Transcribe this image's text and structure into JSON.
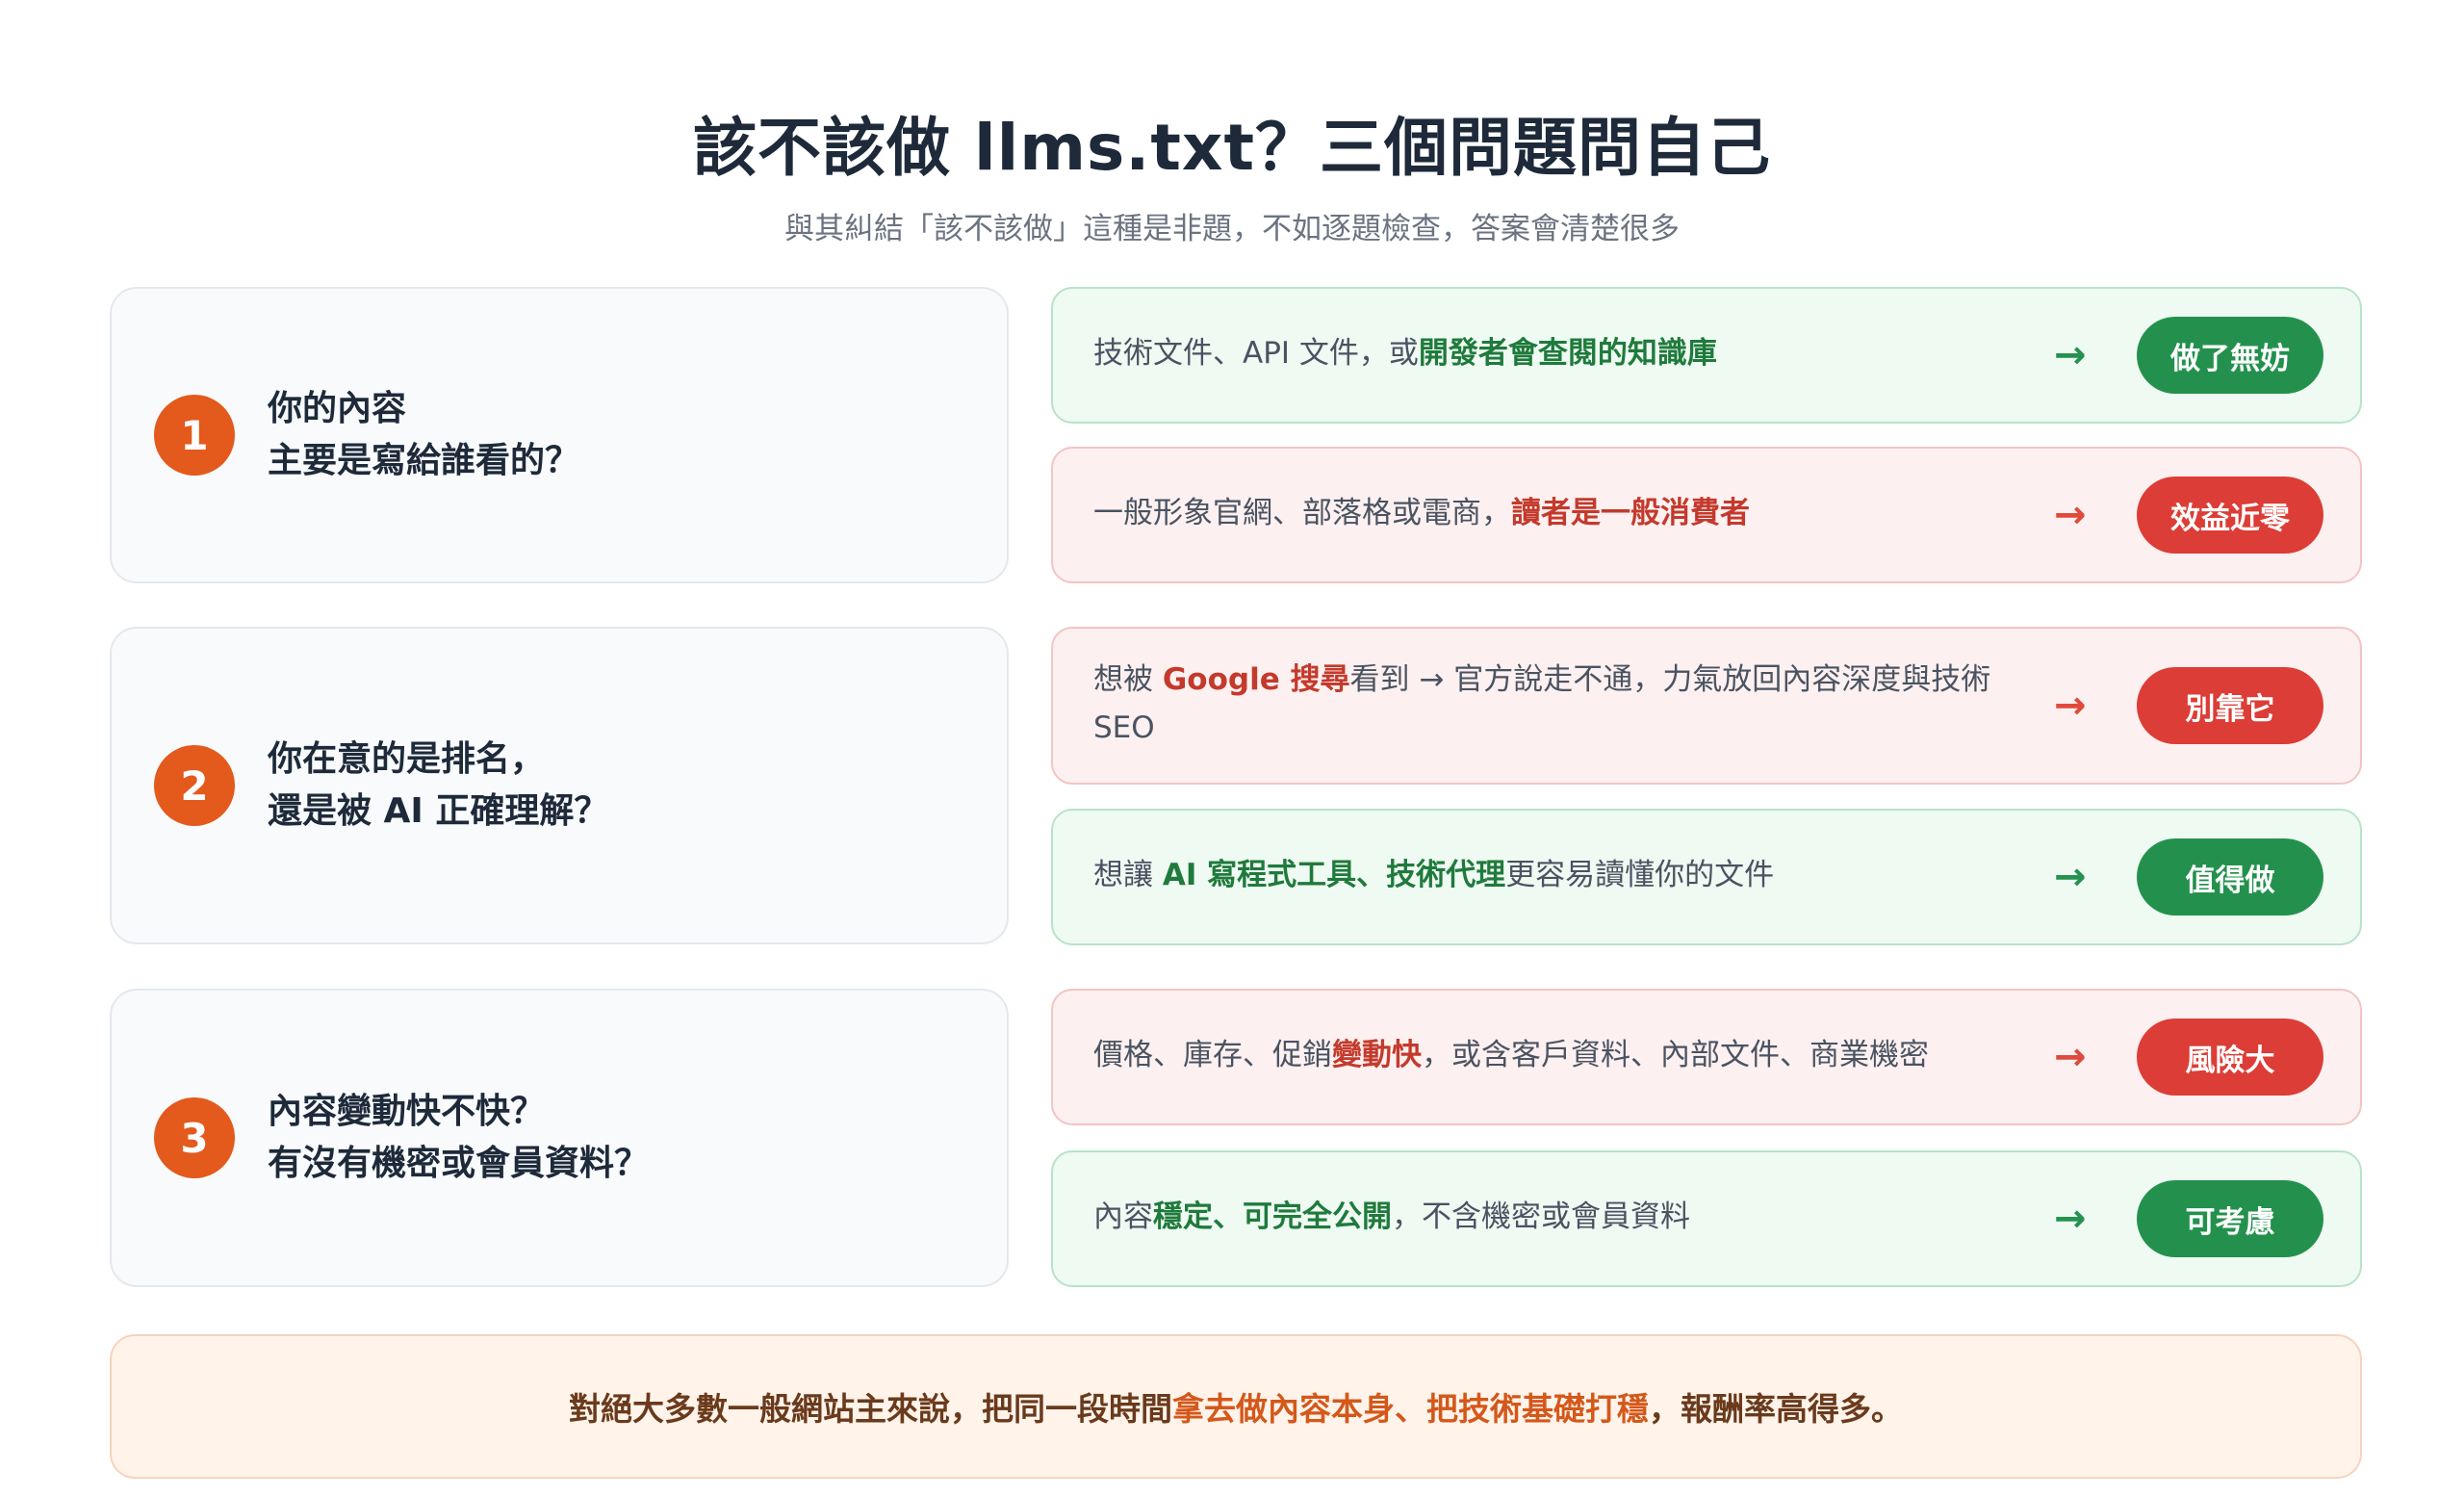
{
  "title": "該不該做 llms.txt？三個問題問自己",
  "subtitle": "與其糾結「該不該做」這種是非題，不如逐題檢查，答案會清楚很多",
  "questions": [
    {
      "number": "1",
      "line1": "你的內容",
      "line2": "主要是寫給誰看的？",
      "answers": [
        {
          "tone": "green",
          "text_a": "技術文件、API 文件，或",
          "text_b": "開發者會查閱的知識庫",
          "text_c": "",
          "arrow": "→",
          "badge": "做了無妨"
        },
        {
          "tone": "red",
          "text_a": "一般形象官網、部落格或電商，",
          "text_b": "讀者是一般消費者",
          "text_c": "",
          "arrow": "→",
          "badge": "效益近零"
        }
      ]
    },
    {
      "number": "2",
      "line1": "你在意的是排名，",
      "line2": "還是被 AI 正確理解？",
      "answers": [
        {
          "tone": "red",
          "text_a": "想被 ",
          "text_b": "Google 搜尋",
          "text_c": "看到 → 官方說走不通，力氣放回內容深度與技術 SEO",
          "arrow": "→",
          "badge": "別靠它"
        },
        {
          "tone": "green",
          "text_a": "想讓 ",
          "text_b": "AI 寫程式工具、技術代理",
          "text_c": "更容易讀懂你的文件",
          "arrow": "→",
          "badge": "值得做"
        }
      ]
    },
    {
      "number": "3",
      "line1": "內容變動快不快？",
      "line2": "有沒有機密或會員資料？",
      "answers": [
        {
          "tone": "red",
          "text_a": "價格、庫存、促銷",
          "text_b": "變動快",
          "text_c": "，或含客戶資料、內部文件、商業機密",
          "arrow": "→",
          "badge": "風險大"
        },
        {
          "tone": "green",
          "text_a": "內容",
          "text_b": "穩定、可完全公開",
          "text_c": "，不含機密或會員資料",
          "arrow": "→",
          "badge": "可考慮"
        }
      ]
    }
  ],
  "footer": {
    "text_a": "對絕大多數一般網站主來說，把同一段時間",
    "text_b": "拿去做內容本身、把技術基礎打穩",
    "text_c": "，報酬率高得多。"
  },
  "colors": {
    "accent_orange": "#e35a1c",
    "green": "#23914d",
    "red": "#dc3d36"
  }
}
